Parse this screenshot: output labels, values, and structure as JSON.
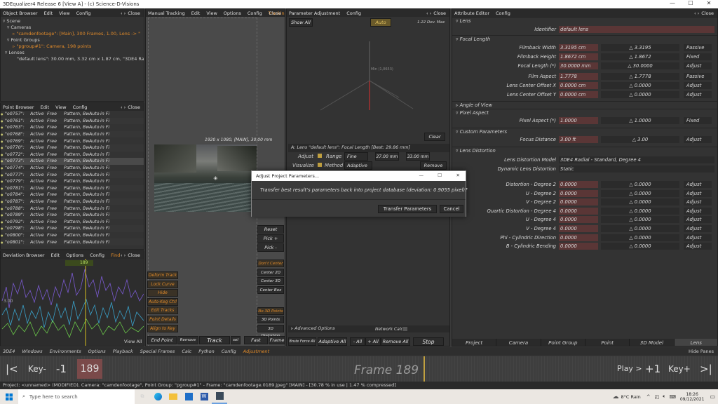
{
  "window": {
    "title": "3DEqualizer4 Release 6 [View A] - (c) Science-D-Visions",
    "min": "—",
    "max": "☐",
    "close": "✕"
  },
  "object_browser": {
    "menu": [
      "Object Browser",
      "Edit",
      "View",
      "Config"
    ],
    "close": "Close",
    "tree": [
      "Scene",
      "Cameras",
      "\"camdenfootage\": [Main], 300 Frames, 1.00, Lens -> \"",
      "Point Groups",
      "\"pgroup#1\": Camera, 198 points",
      "Lenses",
      "\"default lens\": 30.00 mm, 3.32 cm x 1.87 cm, \"3DE4 Radi"
    ]
  },
  "point_browser": {
    "menu": [
      "Point Browser",
      "Edit",
      "View",
      "Config"
    ],
    "close": "Close",
    "rows": [
      [
        "\"o0757\":",
        "Active",
        "Free",
        "Pattern, Bw",
        "Auto",
        "in Fi"
      ],
      [
        "\"o0761\":",
        "Active",
        "Free",
        "Pattern, Bw",
        "Auto",
        "in Fi"
      ],
      [
        "\"o0763\":",
        "Active",
        "Free",
        "Pattern, Bw",
        "Auto",
        "in Fi"
      ],
      [
        "\"o0768\":",
        "Active",
        "Free",
        "Pattern, Bw",
        "Auto",
        "in Fi"
      ],
      [
        "\"o0769\":",
        "Active",
        "Free",
        "Pattern, Bw",
        "Auto",
        "in Fi"
      ],
      [
        "\"o0770\":",
        "Active",
        "Free",
        "Pattern, Bw",
        "Auto",
        "in Fi"
      ],
      [
        "\"o0772\":",
        "Active",
        "Free",
        "Pattern, Bw",
        "Auto",
        "in Fi"
      ],
      [
        "\"o0773\":",
        "Active",
        "Free",
        "Pattern, Bw",
        "Auto",
        "in Fi"
      ],
      [
        "\"o0774\":",
        "Active",
        "Free",
        "Pattern, Bw",
        "Auto",
        "in Fi"
      ],
      [
        "\"o0777\":",
        "Active",
        "Free",
        "Pattern, Bw",
        "Auto",
        "in Fi"
      ],
      [
        "\"o0779\":",
        "Active",
        "Free",
        "Pattern, Bw",
        "Auto",
        "in Fi"
      ],
      [
        "\"o0781\":",
        "Active",
        "Free",
        "Pattern, Bw",
        "Auto",
        "in Fi"
      ],
      [
        "\"o0784\":",
        "Active",
        "Free",
        "Pattern, Bw",
        "Auto",
        "in Fi"
      ],
      [
        "\"o0787\":",
        "Active",
        "Free",
        "Pattern, Bw",
        "Auto",
        "in Fi"
      ],
      [
        "\"o0788\":",
        "Active",
        "Free",
        "Pattern, Bw",
        "Auto",
        "in Fi"
      ],
      [
        "\"o0789\":",
        "Active",
        "Free",
        "Pattern, Bw",
        "Auto",
        "in Fi"
      ],
      [
        "\"o0792\":",
        "Active",
        "Free",
        "Pattern, Bw",
        "Auto",
        "in Fi"
      ],
      [
        "\"o0798\":",
        "Active",
        "Free",
        "Pattern, Bw",
        "Auto",
        "in Fi"
      ],
      [
        "\"o0800\":",
        "Active",
        "Free",
        "Pattern, Bw",
        "Auto",
        "in Fi"
      ],
      [
        "\"o0801\":",
        "Active",
        "Free",
        "Pattern, Bw",
        "Auto",
        "in Fi"
      ]
    ]
  },
  "deviation_browser": {
    "menu": [
      "Deviation Browser",
      "Edit",
      "Options",
      "Config",
      "Find"
    ],
    "close": "Close",
    "frame_label": "189",
    "y_label": "3.00",
    "view_all": "View All"
  },
  "manual_tracking": {
    "menu": [
      "Manual Tracking",
      "Edit",
      "View",
      "Options",
      "Config",
      "Tracking"
    ],
    "close": "Close",
    "image_info": "1920 x 1080, [MAIN], 30.00 mm",
    "side_buttons": [
      "Deform Track",
      "Lock Curve",
      "Hide",
      "Auto-Keg Ctrl",
      "Edit Tracks",
      "Point Details",
      "Align to Key"
    ],
    "right_buttons": [
      "Reset",
      "Pick +",
      "Pick -"
    ],
    "right_obuttons": [
      "Don't Center",
      "Center 2D",
      "Center 3D",
      "Center Box",
      "No 3D Points",
      "3D Points",
      "3D Distortion"
    ],
    "end_point": "End Point",
    "remove_k": "Remove Ke",
    "track": "Track",
    "track_sel": "sel",
    "fast": "Fast",
    "frame_btn": "Frame"
  },
  "param_adjust": {
    "menu": [
      "Parameter Adjustment",
      "Config"
    ],
    "close": "Close",
    "show_all": "Show All",
    "auto": "Auto",
    "dev_max": "1.22 Dev. Max",
    "min_label": "Min (1,0653)",
    "clear": "Clear",
    "lens_line": "A: Lens \"default lens\": Focal Length  [Best: 29.86 mm]",
    "adjust": "Adjust",
    "range": "Range",
    "range_val": "Fine",
    "mm1": "27.00 mm",
    "mm2": "33.00 mm",
    "visualize": "Visualize",
    "method": "Method",
    "method_val": "Adaptive",
    "remove": "Remove",
    "advanced": "Advanced Options",
    "network_calc": "Network Calc",
    "brute_force": "Brute Force All",
    "adaptive_all": "Adaptive All",
    "all_minus": "- All",
    "all_plus": "+ All",
    "remove_all": "Remove All",
    "stop": "Stop"
  },
  "attribute_editor": {
    "menu": [
      "Attribute Editor",
      "Config"
    ],
    "close": "Close",
    "lens_label": "Lens",
    "identifier_label": "Identifier",
    "identifier": "default lens",
    "focal_length_section": "Focal Length",
    "rows": [
      {
        "label": "Filmback Width",
        "val": "3.3195 cm",
        "v2": "3.3195",
        "mode": "Passive"
      },
      {
        "label": "Filmback Height",
        "val": "1.8672 cm",
        "v2": "1.8672",
        "mode": "Fixed"
      },
      {
        "label": "Focal Length (*)",
        "val": "30.0000 mm",
        "v2": "30.0000",
        "mode": "Adjust"
      },
      {
        "label": "Film Aspect",
        "val": "1.7778",
        "v2": "1.7778",
        "mode": "Passive"
      },
      {
        "label": "Lens Center Offset X",
        "val": "0.0000 cm",
        "v2": "0.0000",
        "mode": "Adjust"
      },
      {
        "label": "Lens Center Offset Y",
        "val": "0.0000 cm",
        "v2": "0.0000",
        "mode": "Adjust"
      }
    ],
    "angle_of_view": "Angle of View",
    "pixel_aspect_section": "Pixel Aspect",
    "pixel_aspect": {
      "label": "Pixel Aspect (*)",
      "val": "1.0000",
      "v2": "1.0000",
      "mode": "Fixed"
    },
    "custom_params": "Custom Parameters",
    "focus": {
      "label": "Focus Distance",
      "val": "3.00 ft",
      "v2": "3.00",
      "mode": "Adjust"
    },
    "lens_distortion": "Lens Distortion",
    "model_label": "Lens Distortion Model",
    "model": "3DE4 Radial - Standard, Degree 4",
    "dyn_label": "Dynamic Lens Distortion",
    "dyn": "Static",
    "dist_rows": [
      {
        "label": "Distortion - Degree 2",
        "val": "0.0000",
        "v2": "0.0000",
        "mode": "Adjust"
      },
      {
        "label": "U - Degree 2",
        "val": "0.0000",
        "v2": "0.0000",
        "mode": "Adjust"
      },
      {
        "label": "V - Degree 2",
        "val": "0.0000",
        "v2": "0.0000",
        "mode": "Adjust"
      },
      {
        "label": "Quartic Distortion - Degree 4",
        "val": "0.0000",
        "v2": "0.0000",
        "mode": "Adjust"
      },
      {
        "label": "U - Degree 4",
        "val": "0.0000",
        "v2": "0.0000",
        "mode": "Adjust"
      },
      {
        "label": "V - Degree 4",
        "val": "0.0000",
        "v2": "0.0000",
        "mode": "Adjust"
      },
      {
        "label": "Phi - Cylindric Direction",
        "val": "0.0000",
        "v2": "0.0000",
        "mode": "Adjust"
      },
      {
        "label": "B - Cylindric Bending",
        "val": "0.0000",
        "v2": "0.0000",
        "mode": "Adjust"
      }
    ],
    "tabs": [
      "Project",
      "Camera",
      "Point Group",
      "Point",
      "3D Model",
      "Lens"
    ]
  },
  "menubar": {
    "items": [
      "3DE4",
      "Windows",
      "Environments",
      "Options",
      "Playback",
      "Special Frames",
      "Calc",
      "Python",
      "Config",
      "Adjustment"
    ],
    "hide_panes": "Hide Panes"
  },
  "timeline": {
    "first": "|<",
    "key_prev": "Key-",
    "minus1": "-1",
    "frame_num": "189",
    "frame_label": "Frame 189",
    "play": "Play >",
    "plus1": "+1",
    "key_next": "Key+",
    "last": ">|"
  },
  "status": "Project: <unnamed>  (MODIFIED), Camera: \"camdenfootage\", Point Group: \"pgroup#1\"  -  Frame: \"camdenfootage.0189.jpeg\"  [MAIN]  -  [30.78 % in use | 1.47 % compressed]",
  "dialog": {
    "title": "Adjust Project Parameters...",
    "message": "Transfer best result's parameters back into project database (deviation: 0.9055 pixel)?",
    "transfer": "Transfer Parameters",
    "cancel": "Cancel"
  },
  "taskbar": {
    "search": "Type here to search",
    "weather": "8°C  Rain",
    "time": "18:26",
    "date": "09/12/2021"
  }
}
